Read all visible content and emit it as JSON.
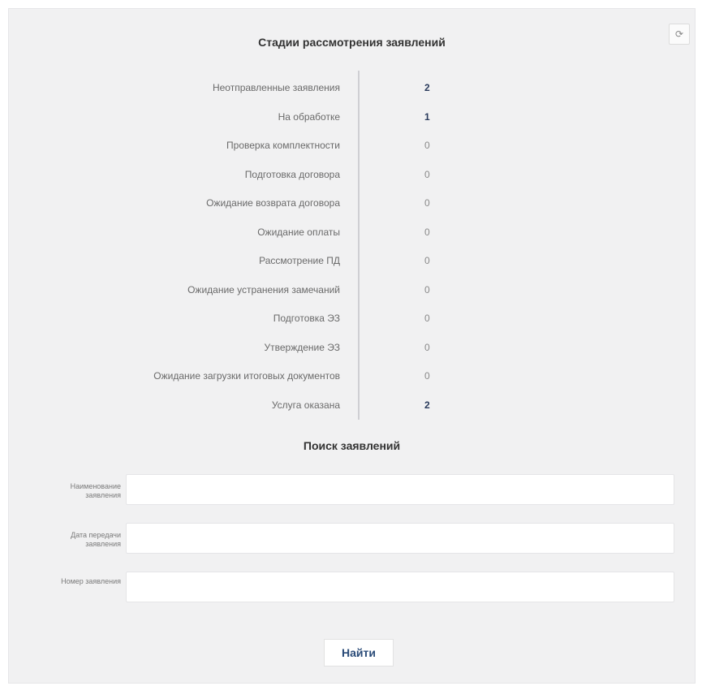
{
  "stages": {
    "title": "Стадии рассмотрения заявлений",
    "refresh_icon": "refresh-icon",
    "refresh_glyph": "⟳",
    "items": [
      {
        "label": "Неотправленные заявления",
        "count": "2",
        "active": true
      },
      {
        "label": "На обработке",
        "count": "1",
        "active": true
      },
      {
        "label": "Проверка комплектности",
        "count": "0",
        "active": false
      },
      {
        "label": "Подготовка договора",
        "count": "0",
        "active": false
      },
      {
        "label": "Ожидание возврата договора",
        "count": "0",
        "active": false
      },
      {
        "label": "Ожидание оплаты",
        "count": "0",
        "active": false
      },
      {
        "label": "Рассмотрение ПД",
        "count": "0",
        "active": false
      },
      {
        "label": "Ожидание устранения замечаний",
        "count": "0",
        "active": false
      },
      {
        "label": "Подготовка ЭЗ",
        "count": "0",
        "active": false
      },
      {
        "label": "Утверждение ЭЗ",
        "count": "0",
        "active": false
      },
      {
        "label": "Ожидание загрузки итоговых документов",
        "count": "0",
        "active": false
      },
      {
        "label": "Услуга оказана",
        "count": "2",
        "active": true
      }
    ]
  },
  "search": {
    "title": "Поиск заявлений",
    "fields": [
      {
        "label_line1": "Наименование",
        "label_line2": "заявления",
        "value": ""
      },
      {
        "label_line1": "Дата передачи",
        "label_line2": "заявления",
        "value": ""
      },
      {
        "label_line1": "Номер заявления",
        "label_line2": "",
        "value": ""
      }
    ],
    "submit_label": "Найти"
  },
  "colors": {
    "panel_bg": "#f1f1f2",
    "active_count": "#2a3b5c",
    "button_text": "#2a4b78"
  }
}
